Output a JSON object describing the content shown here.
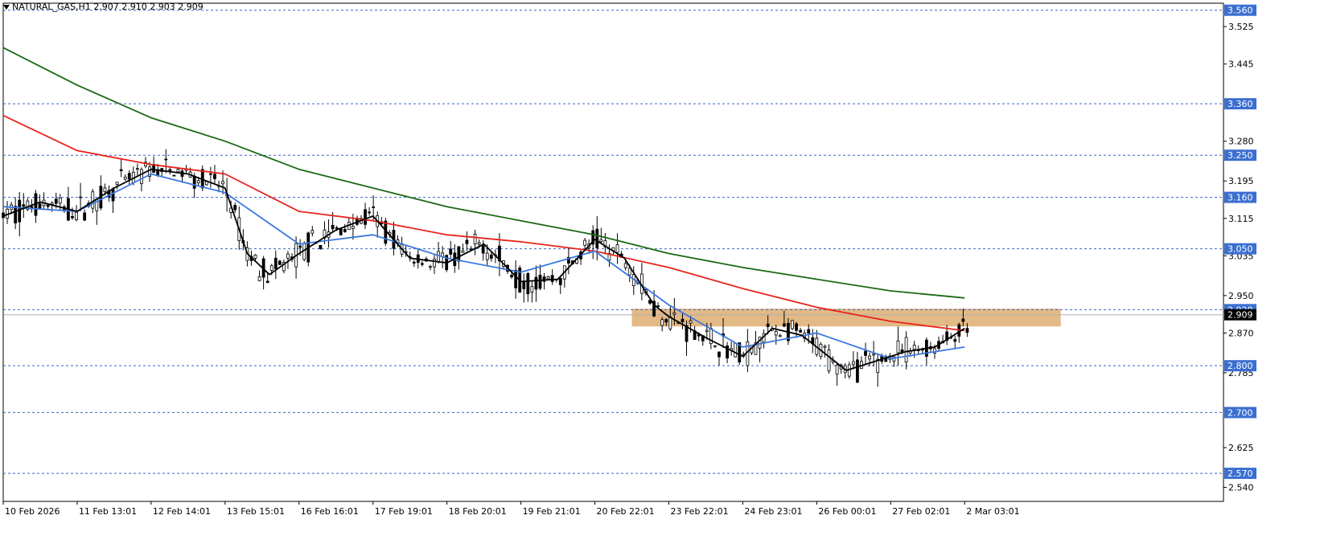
{
  "header": {
    "symbol_line": "NATURAL_GAS,H1  2.907 2.910 2.903 2.909"
  },
  "colors": {
    "background": "#ffffff",
    "grid_level": "#3b64c8",
    "level_label_bg": "#3b6fd0",
    "zone_fill": "#e3b985",
    "ma_fast": "#000000",
    "ma_blue": "#3a78e0",
    "ma_red": "#e8231c",
    "ma_green": "#1a6a14",
    "candles": "#000000",
    "current_price_bg": "#000000"
  },
  "chart_data": {
    "type": "line",
    "instrument": "NATURAL_GAS",
    "timeframe": "H1",
    "ohlc_last": {
      "open": 2.907,
      "high": 2.91,
      "low": 2.903,
      "close": 2.909
    },
    "ylim": [
      2.51,
      3.575
    ],
    "y_ticks": [
      "3.525",
      "3.445",
      "3.280",
      "3.195",
      "3.115",
      "3.035",
      "2.950",
      "2.870",
      "2.785",
      "2.625",
      "2.540"
    ],
    "x_tick_labels": [
      "10 Feb 2026",
      "11 Feb 13:01",
      "12 Feb 14:01",
      "13 Feb 15:01",
      "16 Feb 16:01",
      "17 Feb 19:01",
      "18 Feb 20:01",
      "19 Feb 21:01",
      "20 Feb 22:01",
      "23 Feb 22:01",
      "24 Feb 23:01",
      "26 Feb 00:01",
      "27 Feb 02:01",
      "2 Mar 03:01"
    ],
    "horizontal_levels": [
      3.56,
      3.36,
      3.25,
      3.16,
      3.05,
      2.92,
      2.8,
      2.7,
      2.57
    ],
    "level_labels": [
      "3.560",
      "3.360",
      "3.250",
      "3.160",
      "3.050",
      "2.920",
      "2.800",
      "2.700",
      "2.570"
    ],
    "current_price": 2.909,
    "current_price_label": "2.909",
    "zone": {
      "x_from": 8.5,
      "x_to": 14.3,
      "y_low": 2.884,
      "y_high": 2.922
    },
    "series": [
      {
        "color_key": "ma_green",
        "x": [
          0,
          1,
          2,
          3,
          4,
          5,
          6,
          7,
          8,
          9,
          10,
          11,
          12,
          13
        ],
        "y": [
          3.48,
          3.4,
          3.33,
          3.28,
          3.22,
          3.18,
          3.14,
          3.11,
          3.08,
          3.04,
          3.01,
          2.985,
          2.96,
          2.945
        ]
      },
      {
        "color_key": "ma_red",
        "x": [
          0,
          1,
          2,
          3,
          4,
          5,
          6,
          7,
          8,
          9,
          10,
          11,
          12,
          13
        ],
        "y": [
          3.335,
          3.26,
          3.23,
          3.21,
          3.13,
          3.11,
          3.08,
          3.065,
          3.045,
          3.01,
          2.965,
          2.925,
          2.895,
          2.875
        ]
      },
      {
        "color_key": "ma_blue",
        "x": [
          0,
          1,
          2,
          3,
          4,
          5,
          6,
          7,
          8,
          9,
          10,
          11,
          12,
          13
        ],
        "y": [
          3.14,
          3.13,
          3.21,
          3.17,
          3.06,
          3.08,
          3.03,
          3.0,
          3.045,
          2.93,
          2.84,
          2.87,
          2.815,
          2.84
        ]
      },
      {
        "color_key": "ma_fast",
        "x": [
          0,
          0.5,
          1,
          1.5,
          2,
          2.5,
          3,
          3.3,
          3.6,
          4,
          4.5,
          5,
          5.5,
          6,
          6.5,
          7,
          7.5,
          8,
          8.4,
          8.8,
          9,
          9.5,
          10,
          10.4,
          10.8,
          11,
          11.4,
          11.8,
          12.2,
          12.6,
          13
        ],
        "y": [
          3.12,
          3.15,
          3.13,
          3.18,
          3.22,
          3.21,
          3.18,
          3.04,
          2.995,
          3.04,
          3.09,
          3.12,
          3.03,
          3.02,
          3.06,
          2.98,
          2.985,
          3.07,
          3.03,
          2.93,
          2.905,
          2.86,
          2.82,
          2.88,
          2.865,
          2.84,
          2.79,
          2.81,
          2.83,
          2.84,
          2.88
        ]
      }
    ]
  }
}
